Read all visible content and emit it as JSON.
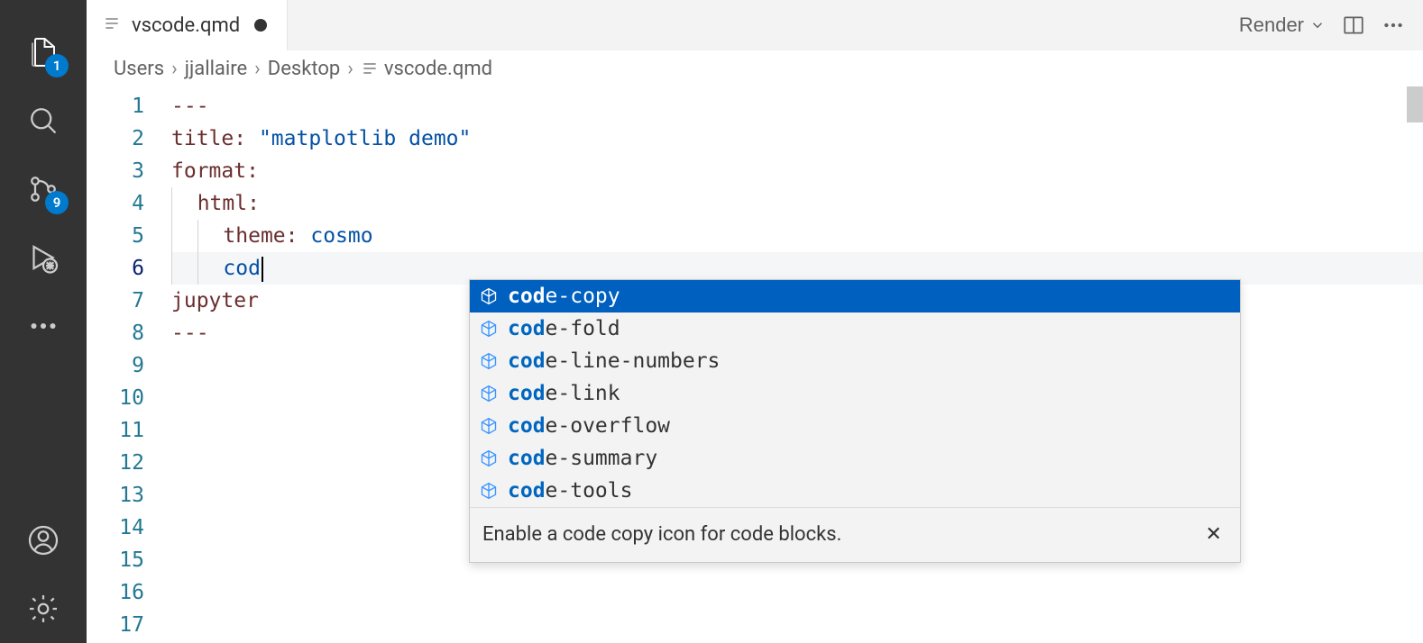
{
  "activity": {
    "explorer_badge": "1",
    "scm_badge": "9"
  },
  "tab": {
    "filename": "vscode.qmd"
  },
  "actions": {
    "render_label": "Render"
  },
  "breadcrumbs": {
    "items": [
      "Users",
      "jjallaire",
      "Desktop",
      "vscode.qmd"
    ]
  },
  "editor": {
    "line_numbers": [
      "1",
      "2",
      "3",
      "4",
      "5",
      "6",
      "7",
      "8",
      "9",
      "10",
      "11",
      "12",
      "13",
      "14",
      "15",
      "16",
      "17"
    ],
    "current_line": 6,
    "lines": {
      "l1": "---",
      "l2_key": "title",
      "l2_val": "\"matplotlib demo\"",
      "l3_key": "format",
      "l4_key": "html",
      "l5_key": "theme",
      "l5_val": "cosmo",
      "l6_partial": "cod",
      "l7_key": "jupyter",
      "l8": "---"
    }
  },
  "suggest": {
    "typed": "cod",
    "items": [
      {
        "prefix": "cod",
        "rest": "e-copy"
      },
      {
        "prefix": "cod",
        "rest": "e-fold"
      },
      {
        "prefix": "cod",
        "rest": "e-line-numbers"
      },
      {
        "prefix": "cod",
        "rest": "e-link"
      },
      {
        "prefix": "cod",
        "rest": "e-overflow"
      },
      {
        "prefix": "cod",
        "rest": "e-summary"
      },
      {
        "prefix": "cod",
        "rest": "e-tools"
      }
    ],
    "detail": "Enable a code copy icon for code blocks."
  }
}
